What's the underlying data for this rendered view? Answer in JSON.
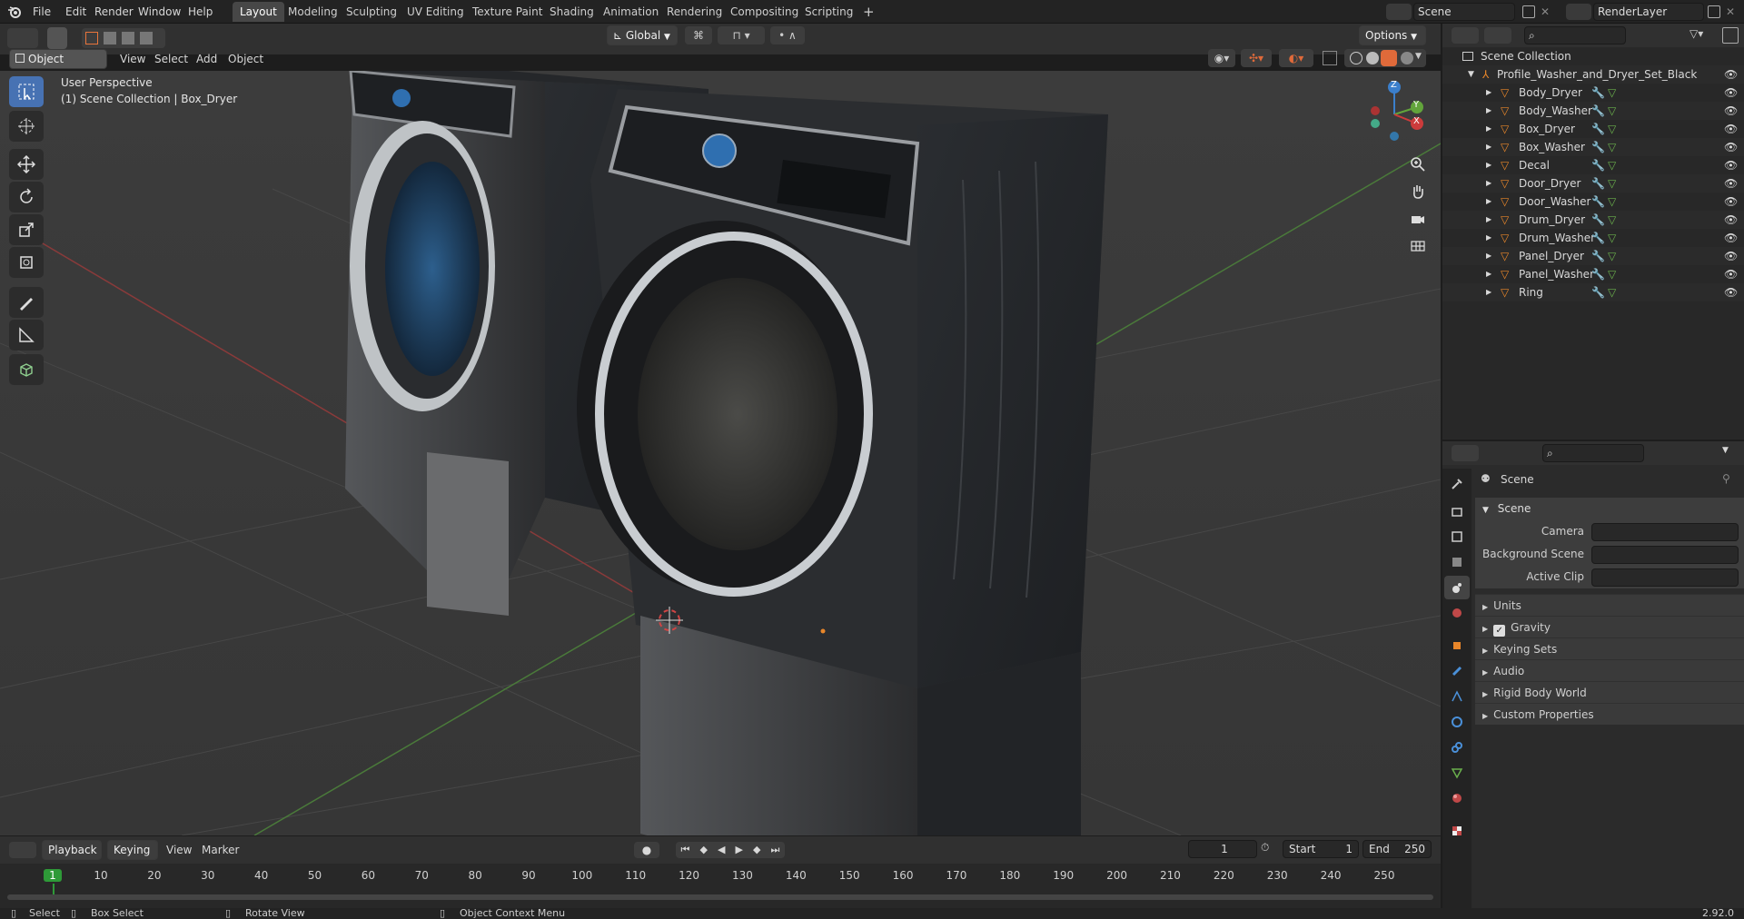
{
  "topbar": {
    "menus": [
      "File",
      "Edit",
      "Render",
      "Window",
      "Help"
    ],
    "workspaces": [
      "Layout",
      "Modeling",
      "Sculpting",
      "UV Editing",
      "Texture Paint",
      "Shading",
      "Animation",
      "Rendering",
      "Compositing",
      "Scripting"
    ],
    "active_workspace": "Layout",
    "add_workspace": "+",
    "scene_name": "Scene",
    "view_layer": "RenderLayer"
  },
  "viewport_header": {
    "mode": "Object Mode",
    "menus": [
      "View",
      "Select",
      "Add",
      "Object"
    ],
    "transform_orientation": "Global",
    "options_label": "Options"
  },
  "viewport": {
    "overlay_line1": "User Perspective",
    "overlay_line2": "(1) Scene Collection | Box_Dryer",
    "gizmo_axes": {
      "x": "X",
      "y": "Y",
      "z": "Z"
    },
    "colors": {
      "x_axis": "#cc3b3b",
      "y_axis": "#62a43b",
      "z_axis": "#3b7fcc"
    },
    "tools": [
      "select-box",
      "cursor",
      "move",
      "rotate",
      "scale",
      "transform",
      "annotate",
      "measure",
      "add-cube"
    ]
  },
  "outliner": {
    "root": "Scene Collection",
    "collection": "Profile_Washer_and_Dryer_Set_Black",
    "objects": [
      "Body_Dryer",
      "Body_Washer",
      "Box_Dryer",
      "Box_Washer",
      "Decal",
      "Door_Dryer",
      "Door_Washer",
      "Drum_Dryer",
      "Drum_Washer",
      "Panel_Dryer",
      "Panel_Washer",
      "Ring"
    ],
    "accent": "#e8862a"
  },
  "properties": {
    "context_title": "Scene",
    "panel_title": "Scene",
    "fields": [
      {
        "label": "Camera",
        "value": ""
      },
      {
        "label": "Background Scene",
        "value": ""
      },
      {
        "label": "Active Clip",
        "value": ""
      }
    ],
    "subpanels": [
      {
        "label": "Units",
        "checkbox": false
      },
      {
        "label": "Gravity",
        "checkbox": true
      },
      {
        "label": "Keying Sets",
        "checkbox": false
      },
      {
        "label": "Audio",
        "checkbox": false
      },
      {
        "label": "Rigid Body World",
        "checkbox": false
      },
      {
        "label": "Custom Properties",
        "checkbox": false
      }
    ]
  },
  "timeline": {
    "menus": [
      "Playback",
      "Keying",
      "View",
      "Marker"
    ],
    "current_frame": "1",
    "start_label": "Start",
    "start_value": "1",
    "end_label": "End",
    "end_value": "250",
    "ticks": [
      "1",
      "10",
      "20",
      "30",
      "40",
      "50",
      "60",
      "70",
      "80",
      "90",
      "100",
      "110",
      "120",
      "130",
      "140",
      "150",
      "160",
      "170",
      "180",
      "190",
      "200",
      "210",
      "220",
      "230",
      "240",
      "250"
    ],
    "current_frame_color": "#2e9a38"
  },
  "statusbar": {
    "select": "Select",
    "box_select": "Box Select",
    "rotate_view": "Rotate View",
    "context_menu": "Object Context Menu",
    "version": "2.92.0"
  }
}
